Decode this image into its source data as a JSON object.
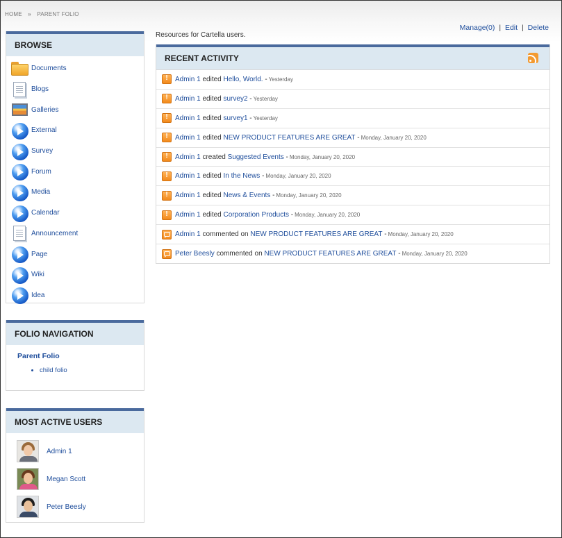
{
  "breadcrumb": {
    "items": [
      "HOME",
      "PARENT FOLIO"
    ],
    "separator": "»"
  },
  "admin": {
    "manage": "Manage(0)",
    "edit": "Edit",
    "delete": "Delete",
    "separator": "|"
  },
  "browse": {
    "title": "BROWSE",
    "items": [
      {
        "label": "Documents",
        "icon": "folder-icon"
      },
      {
        "label": "Blogs",
        "icon": "document-icon"
      },
      {
        "label": "Galleries",
        "icon": "gallery-icon"
      },
      {
        "label": "External",
        "icon": "globe-icon"
      },
      {
        "label": "Survey",
        "icon": "globe-icon"
      },
      {
        "label": "Forum",
        "icon": "globe-icon"
      },
      {
        "label": "Media",
        "icon": "globe-icon"
      },
      {
        "label": "Calendar",
        "icon": "globe-icon"
      },
      {
        "label": "Announcement",
        "icon": "document-icon"
      },
      {
        "label": "Page",
        "icon": "globe-icon"
      },
      {
        "label": "Wiki",
        "icon": "globe-icon"
      },
      {
        "label": "Idea",
        "icon": "globe-icon"
      }
    ]
  },
  "folio_nav": {
    "title": "FOLIO NAVIGATION",
    "parent": "Parent Folio",
    "children": [
      "child folio"
    ]
  },
  "active_users": {
    "title": "MOST ACTIVE USERS",
    "users": [
      {
        "name": "Admin 1"
      },
      {
        "name": "Megan Scott"
      },
      {
        "name": "Peter Beesly"
      }
    ]
  },
  "main": {
    "intro": "Resources for Cartella users."
  },
  "activity": {
    "title": "RECENT ACTIVITY",
    "items": [
      {
        "icon": "alert-icon",
        "user": "Admin 1",
        "action": "edited",
        "target": "Hello, World.",
        "date": "Yesterday"
      },
      {
        "icon": "alert-icon",
        "user": "Admin 1",
        "action": "edited",
        "target": "survey2",
        "date": "Yesterday"
      },
      {
        "icon": "alert-icon",
        "user": "Admin 1",
        "action": "edited",
        "target": "survey1",
        "date": "Yesterday"
      },
      {
        "icon": "alert-icon",
        "user": "Admin 1",
        "action": "edited",
        "target": "NEW PRODUCT FEATURES ARE GREAT",
        "date": "Monday, January 20, 2020"
      },
      {
        "icon": "alert-icon",
        "user": "Admin 1",
        "action": "created",
        "target": "Suggested Events",
        "date": "Monday, January 20, 2020"
      },
      {
        "icon": "alert-icon",
        "user": "Admin 1",
        "action": "edited",
        "target": "In the News",
        "date": "Monday, January 20, 2020"
      },
      {
        "icon": "alert-icon",
        "user": "Admin 1",
        "action": "edited",
        "target": "News & Events",
        "date": "Monday, January 20, 2020"
      },
      {
        "icon": "alert-icon",
        "user": "Admin 1",
        "action": "edited",
        "target": "Corporation Products",
        "date": "Monday, January 20, 2020"
      },
      {
        "icon": "comment-icon",
        "user": "Admin 1",
        "action": "commented on",
        "target": "NEW PRODUCT FEATURES ARE GREAT",
        "date": "Monday, January 20, 2020"
      },
      {
        "icon": "comment-icon",
        "user": "Peter Beesly",
        "action": "commented on",
        "target": "NEW PRODUCT FEATURES ARE GREAT",
        "date": "Monday, January 20, 2020"
      }
    ]
  },
  "colors": {
    "link": "#1f4e9c",
    "header_bg": "#dce8f1",
    "header_border": "#4a6a9d",
    "activity_icon": "#f28a1c"
  }
}
